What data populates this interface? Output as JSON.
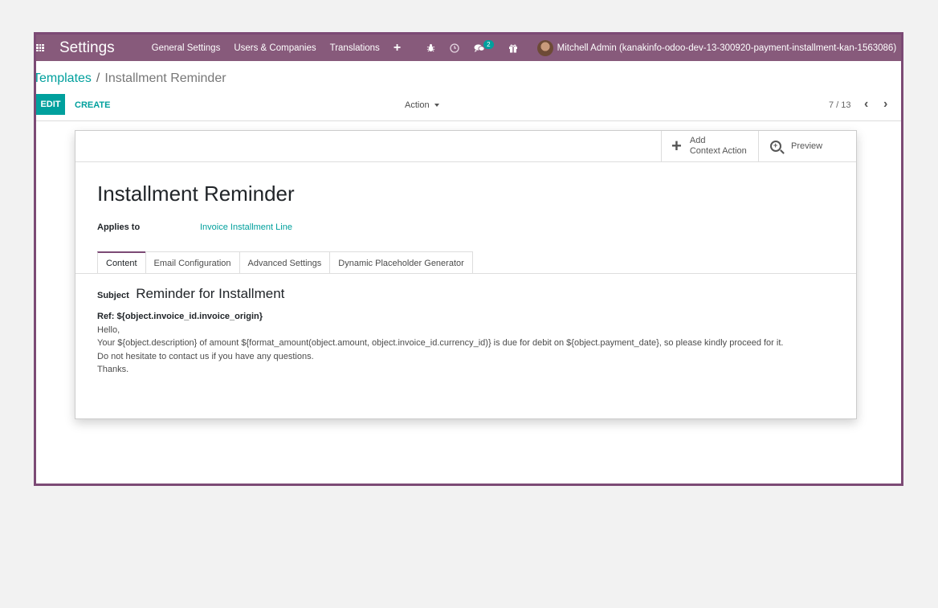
{
  "navbar": {
    "brand": "Settings",
    "menu": [
      "General Settings",
      "Users & Companies",
      "Translations"
    ],
    "plus": "+",
    "messages_badge": "2",
    "user_name": "Mitchell Admin (kanakinfo-odoo-dev-13-300920-payment-installment-kan-1563086)"
  },
  "breadcrumb": {
    "parent": "Templates",
    "separator": "/",
    "current": "Installment Reminder"
  },
  "control_panel": {
    "edit_label": "EDIT",
    "create_label": "CREATE",
    "action_label": "Action",
    "pager_value": "7 / 13"
  },
  "sheet": {
    "buttons": {
      "add_line1": "Add",
      "add_line2": "Context Action",
      "preview": "Preview"
    },
    "title": "Installment Reminder",
    "applies_to_label": "Applies to",
    "applies_to_value": "Invoice Installment Line",
    "tabs": [
      "Content",
      "Email Configuration",
      "Advanced Settings",
      "Dynamic Placeholder Generator"
    ],
    "subject_label": "Subject",
    "subject_value": "Reminder for Installment",
    "body": {
      "ref": "Ref: ${object.invoice_id.invoice_origin}",
      "line1": "Hello,",
      "line2": "Your ${object.description} of amount ${format_amount(object.amount, object.invoice_id.currency_id)} is due for debit on ${object.payment_date}, so please kindly proceed for it.",
      "line3": "Do not hesitate to contact us if you have any questions.",
      "line4": "Thanks."
    }
  },
  "colors": {
    "navbar": "#875a7b",
    "frame_border": "#7c4a75",
    "accent": "#00a09d"
  }
}
